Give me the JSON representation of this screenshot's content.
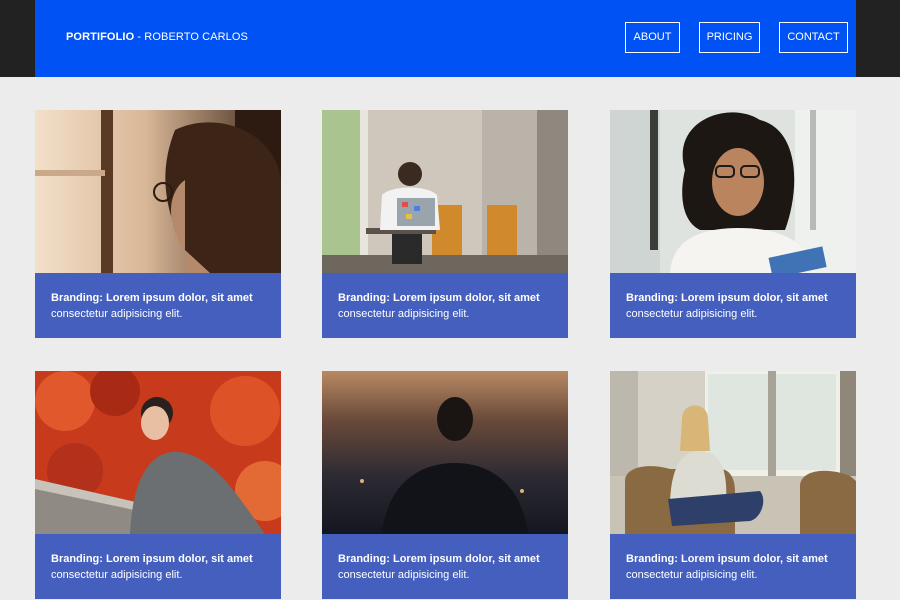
{
  "header": {
    "brand_bold": "PORTIFOLIO",
    "brand_rest": " - ROBERTO CARLOS",
    "nav": [
      "ABOUT",
      "PRICING",
      "CONTACT"
    ]
  },
  "cards": [
    {
      "title": "Branding: Lorem ipsum dolor, sit amet",
      "subtitle": "consectetur adipisicing elit."
    },
    {
      "title": "Branding: Lorem ipsum dolor, sit amet",
      "subtitle": "consectetur adipisicing elit."
    },
    {
      "title": "Branding: Lorem ipsum dolor, sit amet",
      "subtitle": "consectetur adipisicing elit."
    },
    {
      "title": "Branding: Lorem ipsum dolor, sit amet",
      "subtitle": "consectetur adipisicing elit."
    },
    {
      "title": "Branding: Lorem ipsum dolor, sit amet",
      "subtitle": "consectetur adipisicing elit."
    },
    {
      "title": "Branding: Lorem ipsum dolor, sit amet",
      "subtitle": "consectetur adipisicing elit."
    }
  ],
  "colors": {
    "header": "#0052f5",
    "top_band": "#222222",
    "caption": "#445fbe",
    "page": "#ececec"
  }
}
